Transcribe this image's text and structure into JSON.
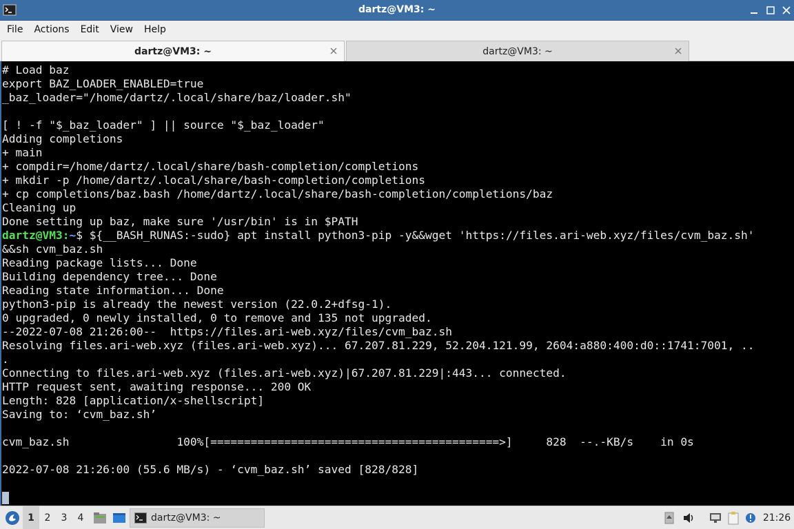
{
  "window": {
    "title": "dartz@VM3: ~"
  },
  "menu": [
    "File",
    "Actions",
    "Edit",
    "View",
    "Help"
  ],
  "tabs": [
    {
      "label": "dartz@VM3: ~",
      "active": true
    },
    {
      "label": "dartz@VM3: ~",
      "active": false
    }
  ],
  "terminal": {
    "lines_before": [
      "# Load baz",
      "export BAZ_LOADER_ENABLED=true",
      "_baz_loader=\"/home/dartz/.local/share/baz/loader.sh\"",
      "",
      "[ ! -f \"$_baz_loader\" ] || source \"$_baz_loader\"",
      "Adding completions",
      "+ main",
      "+ compdir=/home/dartz/.local/share/bash-completion/completions",
      "+ mkdir -p /home/dartz/.local/share/bash-completion/completions",
      "+ cp completions/baz.bash /home/dartz/.local/share/bash-completion/completions/baz",
      "Cleaning up",
      "Done setting up baz, make sure '/usr/bin' is in $PATH"
    ],
    "prompt_user": "dartz@VM3",
    "prompt_sep": ":",
    "prompt_path": "~",
    "command": "$ ${__BASH_RUNAS:-sudo} apt install python3-pip -y&&wget 'https://files.ari-web.xyz/files/cvm_baz.sh'",
    "lines_after": [
      "&&sh cvm_baz.sh",
      "Reading package lists... Done",
      "Building dependency tree... Done",
      "Reading state information... Done",
      "python3-pip is already the newest version (22.0.2+dfsg-1).",
      "0 upgraded, 0 newly installed, 0 to remove and 135 not upgraded.",
      "--2022-07-08 21:26:00--  https://files.ari-web.xyz/files/cvm_baz.sh",
      "Resolving files.ari-web.xyz (files.ari-web.xyz)... 67.207.81.229, 52.204.121.99, 2604:a880:400:d0::1741:7001, ..",
      ".",
      "Connecting to files.ari-web.xyz (files.ari-web.xyz)|67.207.81.229|:443... connected.",
      "HTTP request sent, awaiting response... 200 OK",
      "Length: 828 [application/x-shellscript]",
      "Saving to: ‘cvm_baz.sh’",
      "",
      "cvm_baz.sh                100%[===========================================>]     828  --.-KB/s    in 0s",
      "",
      "2022-07-08 21:26:00 (55.6 MB/s) - ‘cvm_baz.sh’ saved [828/828]",
      ""
    ]
  },
  "taskbar": {
    "workspaces": [
      "1",
      "2",
      "3",
      "4"
    ],
    "active_workspace": "1",
    "task_label": "dartz@VM3: ~",
    "clock": "21:26"
  },
  "colors": {
    "titlebar": "#3a6ea5",
    "prompt_user": "#55e055",
    "prompt_path": "#6aa0ff"
  }
}
